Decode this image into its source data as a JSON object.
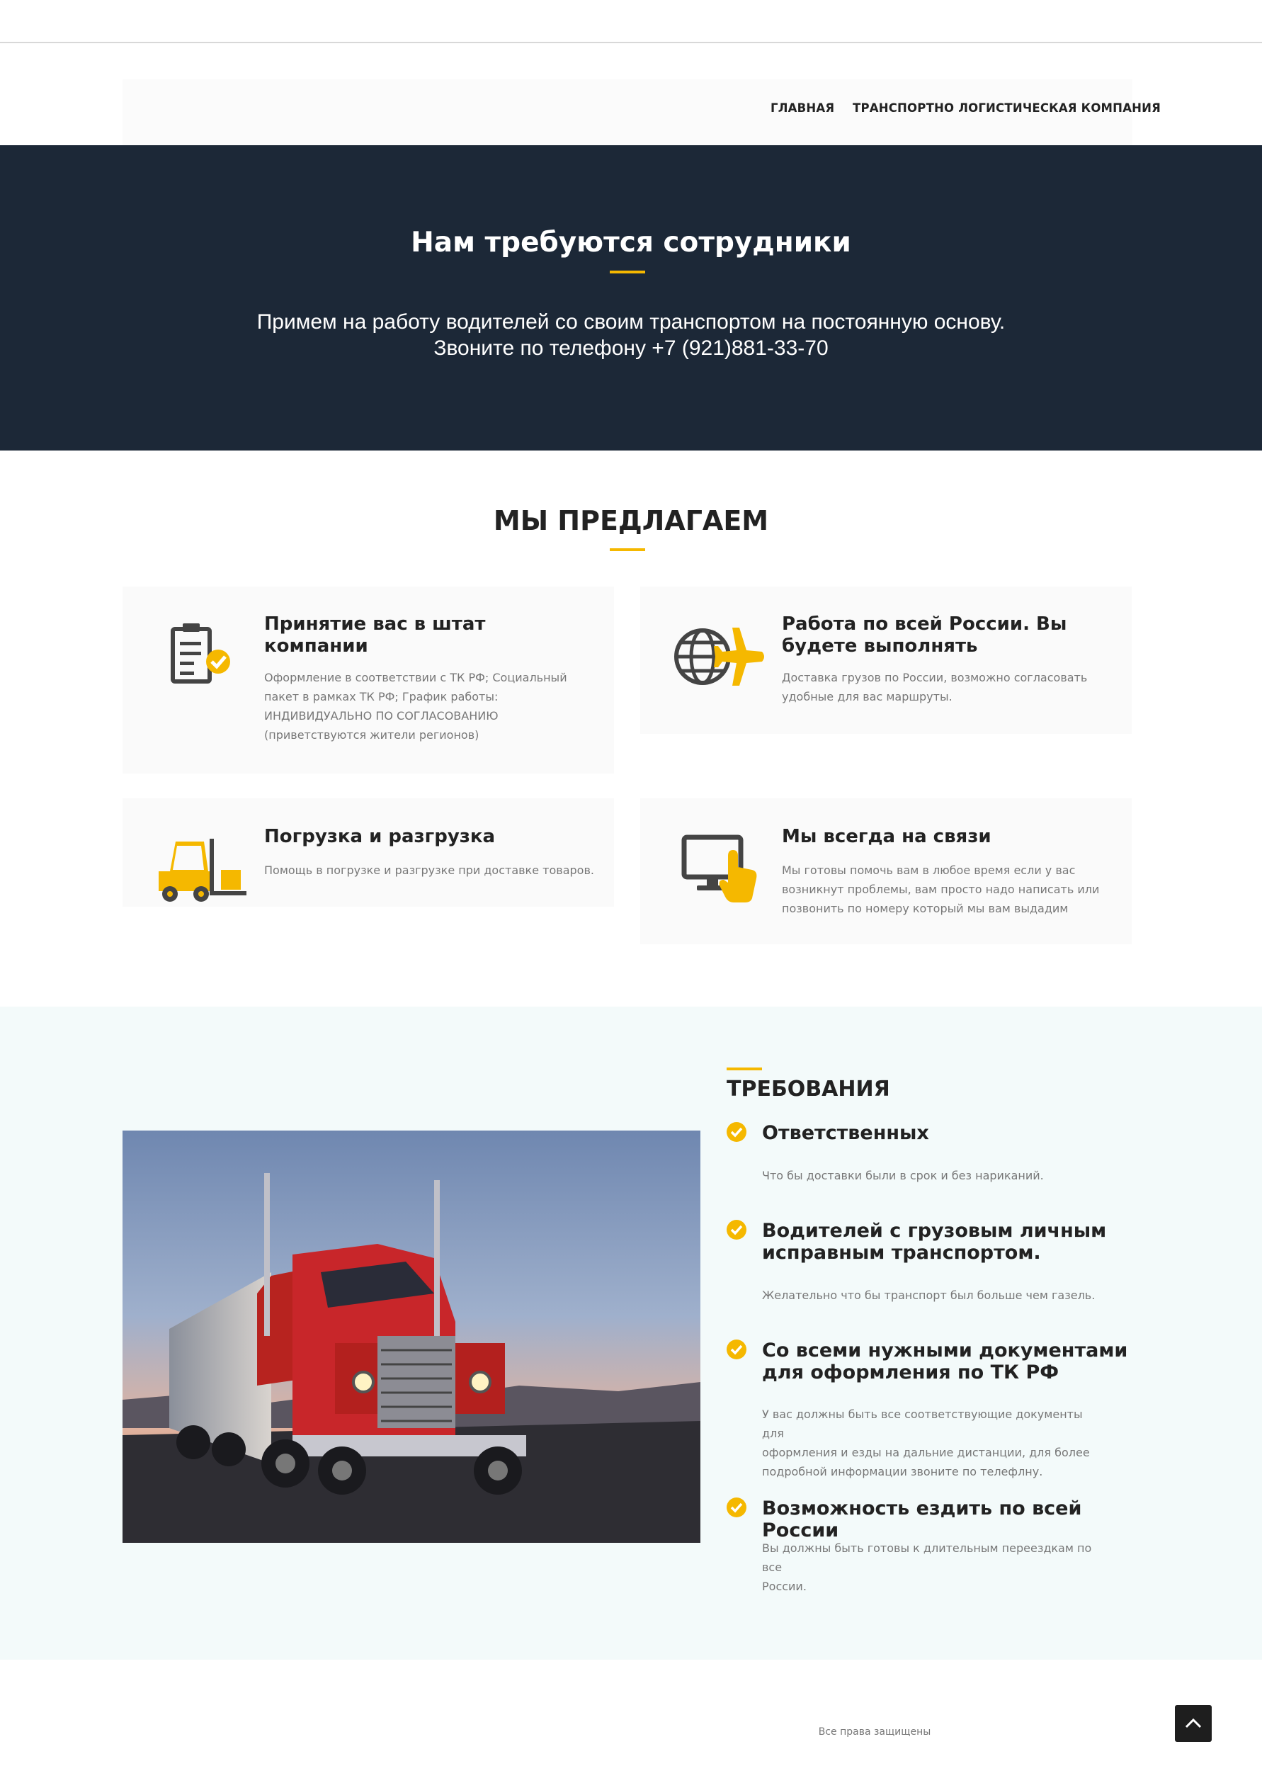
{
  "nav": {
    "home": "ГЛАВНАЯ",
    "company": "ТРАНСПОРТНО ЛОГИСТИЧЕСКАЯ КОМПАНИЯ"
  },
  "hero": {
    "title": "Нам требуются сотрудники",
    "line1": "Примем на работу водителей со своим транспортом на постоянную основу.",
    "line2": "Звоните по телефону +7 (921)881-33-70"
  },
  "offer": {
    "title": "МЫ ПРЕДЛАГАЕМ",
    "cards": [
      {
        "icon": "clipboard-check-icon",
        "title_l1": "Принятие вас в штат",
        "title_l2": "компании",
        "text_l1": "Оформление в соответствии с ТК РФ; Социальный",
        "text_l2": "пакет в рамках ТК РФ; График работы:",
        "text_l3": "ИНДИВИДУАЛЬНО ПО СОГЛАСОВАНИЮ",
        "text_l4": "(приветствуются жители регионов)"
      },
      {
        "icon": "globe-plane-icon",
        "title_l1": "Работа по всей России. Вы",
        "title_l2": "будете выполнять",
        "text_l1": "Доставка грузов по России, возможно согласовать",
        "text_l2": "удобные для вас маршруты."
      },
      {
        "icon": "forklift-icon",
        "title_l1": "Погрузка и разгрузка",
        "text_l1": "Помощь в погрузке и разгрузке при доставке товаров."
      },
      {
        "icon": "monitor-touch-icon",
        "title_l1": "Мы всегда на связи",
        "text_l1": "Мы готовы помочь вам в любое время если у вас",
        "text_l2": "возникнут проблемы, вам просто надо написать или",
        "text_l3": "позвонить по номеру который мы вам выдадим"
      }
    ]
  },
  "requirements": {
    "title": "ТРЕБОВАНИЯ",
    "image": "red-truck-photo",
    "items": [
      {
        "title_l1": "Ответственных",
        "text_l1": "Что бы доставки были в срок и без нариканий."
      },
      {
        "title_l1": "Водителей с грузовым личным",
        "title_l2": "исправным транспортом.",
        "text_l1": "Желательно что бы транспорт был больше чем газель."
      },
      {
        "title_l1": "Со всеми нужными документами",
        "title_l2": "для оформления по ТК РФ",
        "text_l1": "У вас должны быть все соответствующие документы для",
        "text_l2": "оформления и езды на дальние дистанции, для более",
        "text_l3": "подробной информации звоните по телефлну."
      },
      {
        "title_l1": "Возможность ездить по всей России",
        "text_l1": "Вы должны быть готовы к длительным переездкам по все",
        "text_l2": "России."
      }
    ]
  },
  "footer": {
    "copyright": "Все права защищены"
  },
  "colors": {
    "accent": "#f5b800",
    "hero_bg": "#1c2837",
    "icon_dark": "#444444"
  }
}
